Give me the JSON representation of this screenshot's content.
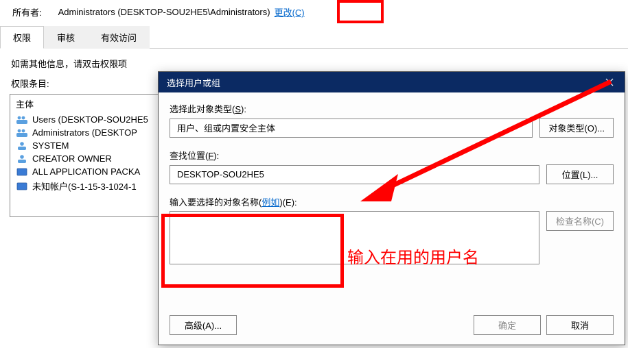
{
  "owner": {
    "label": "所有者:",
    "value": "Administrators (DESKTOP-SOU2HE5\\Administrators)",
    "change": "更改(C)"
  },
  "tabs": {
    "perm": "权限",
    "audit": "审核",
    "effective": "有效访问"
  },
  "info_text": "如需其他信息，请双击权限项",
  "entries_label": "权限条目:",
  "entries_header": "主体",
  "entries": [
    {
      "label": "Users (DESKTOP-SOU2HE5"
    },
    {
      "label": "Administrators (DESKTOP"
    },
    {
      "label": "SYSTEM"
    },
    {
      "label": "CREATOR OWNER"
    },
    {
      "label": "ALL APPLICATION PACKA"
    },
    {
      "label": "未知帐户(S-1-15-3-1024-1"
    }
  ],
  "dialog": {
    "title": "选择用户或组",
    "object_type_label_pre": "选择此对象类型(",
    "object_type_label_accel": "S",
    "object_type_label_post": "):",
    "object_type_value": "用户、组或内置安全主体",
    "object_type_btn": "对象类型(O)...",
    "location_label_pre": "查找位置(",
    "location_label_accel": "F",
    "location_label_post": "):",
    "location_value": "DESKTOP-SOU2HE5",
    "location_btn": "位置(L)...",
    "name_label_pre": "输入要选择的对象名称(",
    "name_label_link": "例如",
    "name_label_mid": ")(",
    "name_label_accel": "E",
    "name_label_post": "):",
    "name_value": "",
    "check_btn": "检查名称(C)",
    "advanced_btn": "高级(A)...",
    "ok_btn": "确定",
    "cancel_btn": "取消"
  },
  "annotation": {
    "text": "输入在用的用户名"
  }
}
